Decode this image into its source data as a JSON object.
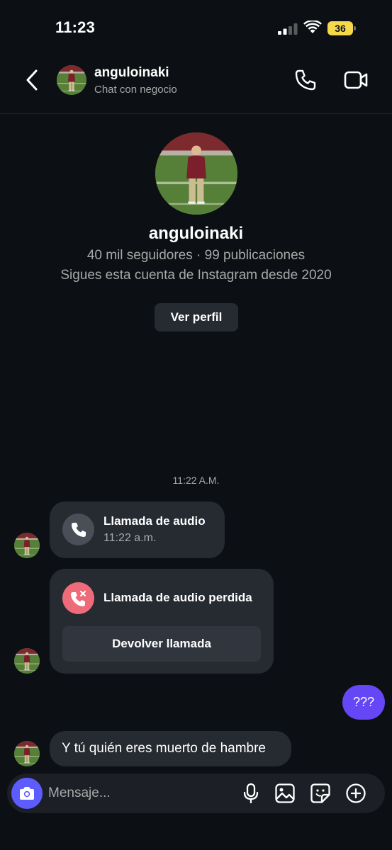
{
  "status_bar": {
    "time": "11:23",
    "battery": "36"
  },
  "header": {
    "username": "anguloinaki",
    "subtitle": "Chat con negocio"
  },
  "profile": {
    "username": "anguloinaki",
    "stats": "40 mil seguidores · 99 publicaciones",
    "since": "Sigues esta cuenta de Instagram desde 2020",
    "view_profile_label": "Ver perfil"
  },
  "conversation": {
    "timestamp": "11:22 A.M.",
    "audio_call": {
      "title": "Llamada de audio",
      "time": "11:22 a.m."
    },
    "missed_call": {
      "title": "Llamada de audio perdida",
      "callback_label": "Devolver llamada"
    },
    "my_message": "???",
    "their_message": "Y tú quién eres muerto de hambre"
  },
  "composer": {
    "placeholder": "Mensaje..."
  },
  "colors": {
    "accent": "#6547f5",
    "camera_button": "#5c5cff",
    "missed": "#ee6b7a",
    "background": "#0c1014",
    "battery": "#f5d94a"
  }
}
